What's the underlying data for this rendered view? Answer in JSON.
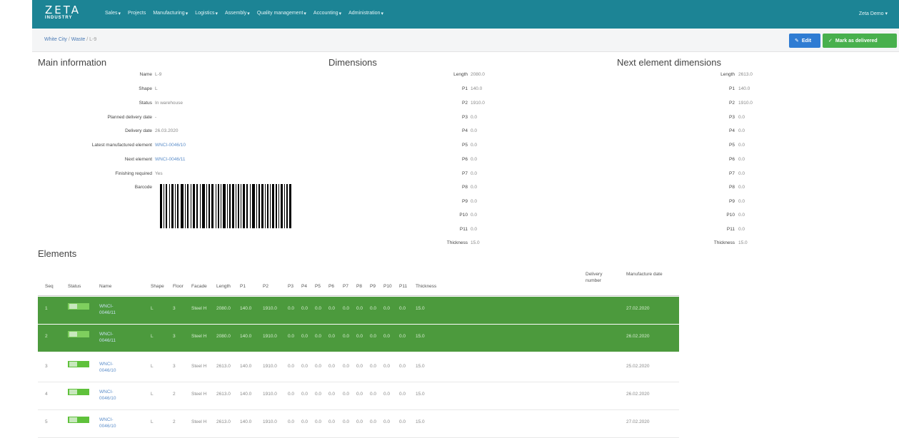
{
  "nav": {
    "brand_line1": "ZETA",
    "brand_line2": "INDUSTRY",
    "menu": [
      "Sales",
      "Projects",
      "Manufacturing",
      "Logistics",
      "Assembly",
      "Quality management",
      "Accounting",
      "Administration"
    ],
    "user": "Zeta Demo"
  },
  "breadcrumb": {
    "parts": [
      "White City",
      "Waste",
      "L-9"
    ]
  },
  "toolbar": {
    "edit_label": "Edit",
    "delivered_label": "Mark as delivered"
  },
  "main_info": {
    "title": "Main information",
    "fields": [
      {
        "label": "Name",
        "value": "L-9"
      },
      {
        "label": "Shape",
        "value": "L"
      },
      {
        "label": "Status",
        "value": "In warehouse"
      },
      {
        "label": "Planned delivery date",
        "value": "-"
      },
      {
        "label": "Delivery date",
        "value": "26.03.2020"
      },
      {
        "label": "Latest manufactured element",
        "value": "WNCI-0046/10"
      },
      {
        "label": "Next element",
        "value": "WNCI-0046/11"
      },
      {
        "label": "Finishing required",
        "value": "Yes"
      },
      {
        "label": "Barcode",
        "value": ""
      }
    ]
  },
  "dimensions": {
    "title": "Dimensions",
    "fields": [
      {
        "label": "Length",
        "value": "2080.0"
      },
      {
        "label": "P1",
        "value": "140.0"
      },
      {
        "label": "P2",
        "value": "1910.0"
      },
      {
        "label": "P3",
        "value": "0.0"
      },
      {
        "label": "P4",
        "value": "0.0"
      },
      {
        "label": "P5",
        "value": "0.0"
      },
      {
        "label": "P6",
        "value": "0.0"
      },
      {
        "label": "P7",
        "value": "0.0"
      },
      {
        "label": "P8",
        "value": "0.0"
      },
      {
        "label": "P9",
        "value": "0.0"
      },
      {
        "label": "P10",
        "value": "0.0"
      },
      {
        "label": "P11",
        "value": "0.0"
      },
      {
        "label": "Thickness",
        "value": "15.0"
      }
    ]
  },
  "next_dimensions": {
    "title": "Next element dimensions",
    "fields": [
      {
        "label": "Length",
        "value": "2613.0"
      },
      {
        "label": "P1",
        "value": "140.0"
      },
      {
        "label": "P2",
        "value": "1910.0"
      },
      {
        "label": "P3",
        "value": "0.0"
      },
      {
        "label": "P4",
        "value": "0.0"
      },
      {
        "label": "P5",
        "value": "0.0"
      },
      {
        "label": "P6",
        "value": "0.0"
      },
      {
        "label": "P7",
        "value": "0.0"
      },
      {
        "label": "P8",
        "value": "0.0"
      },
      {
        "label": "P9",
        "value": "0.0"
      },
      {
        "label": "P10",
        "value": "0.0"
      },
      {
        "label": "P11",
        "value": "0.0"
      },
      {
        "label": "Thickness",
        "value": "15.0"
      }
    ]
  },
  "elements": {
    "title": "Elements",
    "columns": [
      "Seq",
      "Status",
      "Name",
      "Shape",
      "Floor",
      "Facade",
      "Length",
      "P1",
      "P2",
      "P3",
      "P4",
      "P5",
      "P6",
      "P7",
      "P8",
      "P9",
      "P10",
      "P11",
      "Thickness",
      "Delivery number",
      "Manufacture date"
    ],
    "rows": [
      {
        "seq": "1",
        "name": "WNCI-0046/11",
        "shape": "L",
        "floor": "3",
        "facade": "Steel H",
        "length": "2080.0",
        "p1": "140.0",
        "p2": "1910.0",
        "p3": "0.0",
        "p4": "0.0",
        "p5": "0.0",
        "p6": "0.0",
        "p7": "0.0",
        "p8": "0.0",
        "p9": "0.0",
        "p10": "0.0",
        "p11": "0.0",
        "thickness": "15.0",
        "delivery": "",
        "date": "27.02.2020",
        "highlight": true
      },
      {
        "seq": "2",
        "name": "WNCI-0046/11",
        "shape": "L",
        "floor": "3",
        "facade": "Steel H",
        "length": "2080.0",
        "p1": "140.0",
        "p2": "1910.0",
        "p3": "0.0",
        "p4": "0.0",
        "p5": "0.0",
        "p6": "0.0",
        "p7": "0.0",
        "p8": "0.0",
        "p9": "0.0",
        "p10": "0.0",
        "p11": "0.0",
        "thickness": "15.0",
        "delivery": "",
        "date": "26.02.2020",
        "highlight": true
      },
      {
        "seq": "3",
        "name": "WNCI-0046/10",
        "shape": "L",
        "floor": "3",
        "facade": "Steel H",
        "length": "2613.0",
        "p1": "140.0",
        "p2": "1910.0",
        "p3": "0.0",
        "p4": "0.0",
        "p5": "0.0",
        "p6": "0.0",
        "p7": "0.0",
        "p8": "0.0",
        "p9": "0.0",
        "p10": "0.0",
        "p11": "0.0",
        "thickness": "15.0",
        "delivery": "",
        "date": "25.02.2020",
        "highlight": false
      },
      {
        "seq": "4",
        "name": "WNCI-0046/10",
        "shape": "L",
        "floor": "2",
        "facade": "Steel H",
        "length": "2613.0",
        "p1": "140.0",
        "p2": "1910.0",
        "p3": "0.0",
        "p4": "0.0",
        "p5": "0.0",
        "p6": "0.0",
        "p7": "0.0",
        "p8": "0.0",
        "p9": "0.0",
        "p10": "0.0",
        "p11": "0.0",
        "thickness": "15.0",
        "delivery": "",
        "date": "26.02.2020",
        "highlight": false
      },
      {
        "seq": "5",
        "name": "WNCI-0046/10",
        "shape": "L",
        "floor": "2",
        "facade": "Steel H",
        "length": "2613.0",
        "p1": "140.0",
        "p2": "1910.0",
        "p3": "0.0",
        "p4": "0.0",
        "p5": "0.0",
        "p6": "0.0",
        "p7": "0.0",
        "p8": "0.0",
        "p9": "0.0",
        "p10": "0.0",
        "p11": "0.0",
        "thickness": "15.0",
        "delivery": "",
        "date": "27.02.2020",
        "highlight": false
      }
    ]
  },
  "colors": {
    "nav": "#1c8495",
    "edit": "#2f7cd3",
    "delivered": "#48b04d",
    "row_highlight": "#4c9a3d",
    "link": "#5b8dc9"
  }
}
